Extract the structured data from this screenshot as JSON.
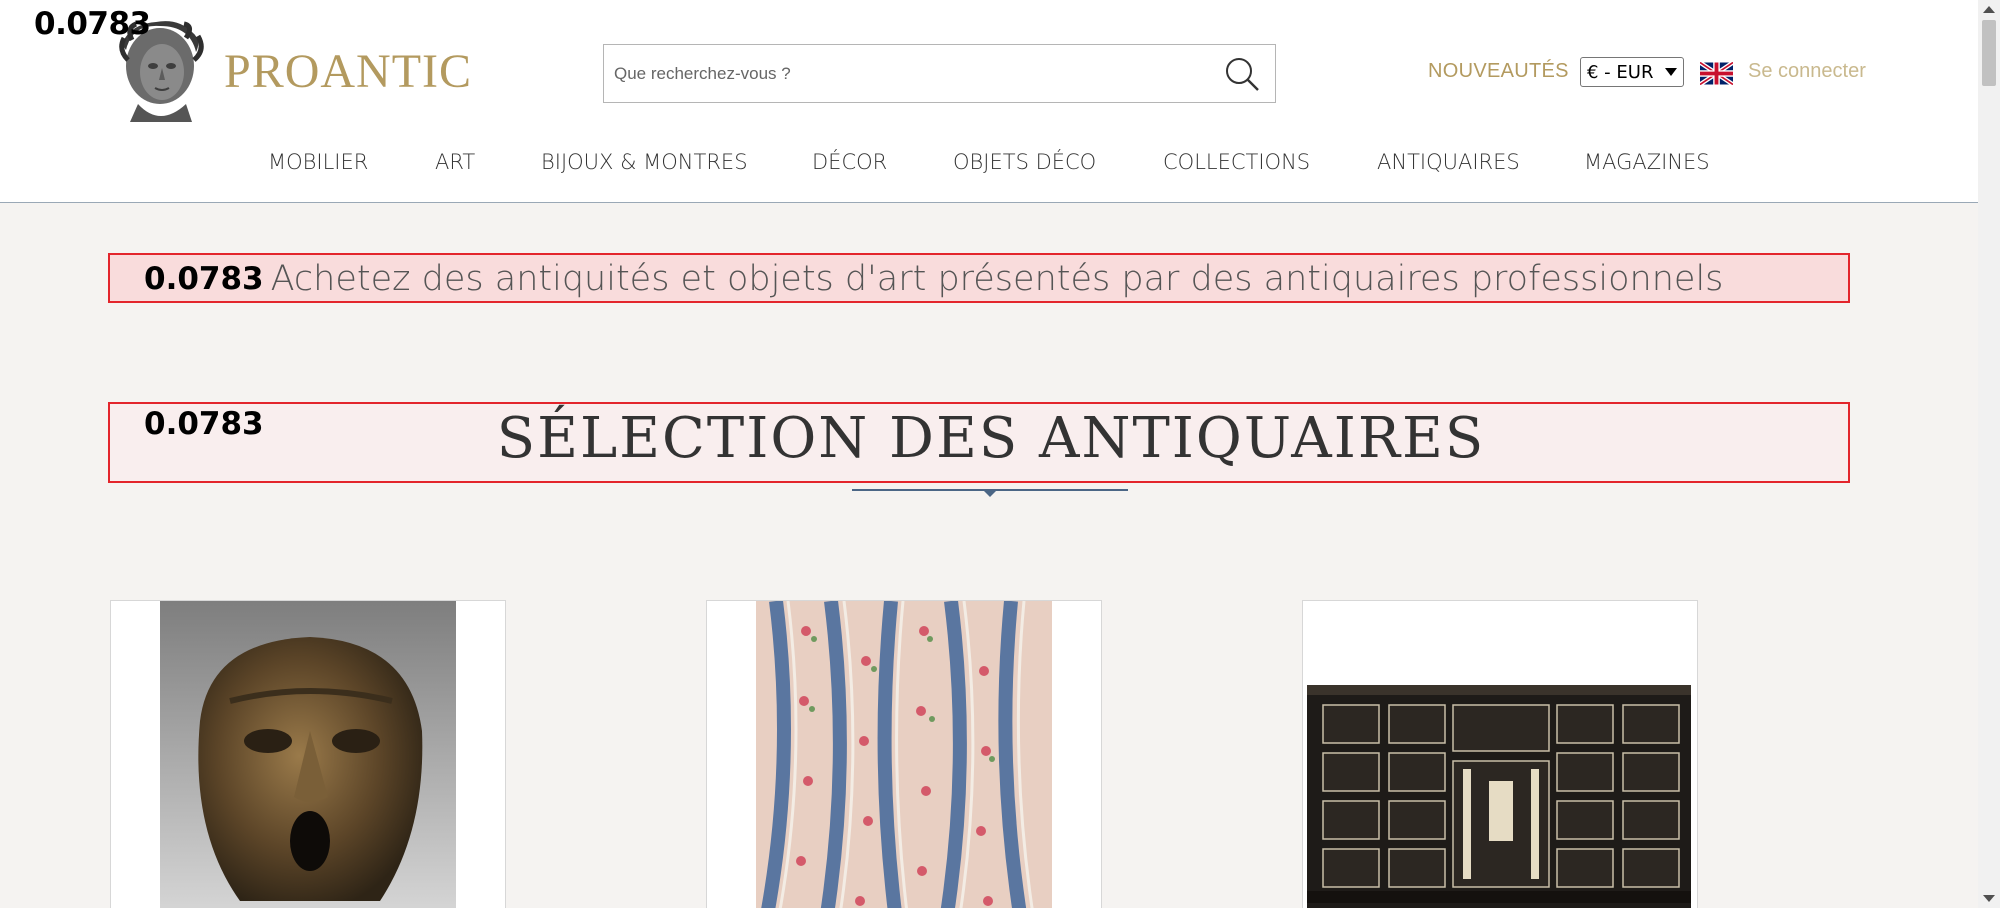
{
  "overlay_value": "0.0783",
  "header": {
    "brand": "PROANTIC",
    "search_placeholder": "Que recherchez-vous ?",
    "nouveautes": "NOUVEAUTÉS",
    "currency": "€ - EUR",
    "login": "Se connecter",
    "icons": [
      "bust-logo",
      "search-icon",
      "uk-flag-icon"
    ]
  },
  "nav": {
    "items": [
      "MOBILIER",
      "ART",
      "BIJOUX & MONTRES",
      "DÉCOR",
      "OBJETS DÉCO",
      "COLLECTIONS",
      "ANTIQUAIRES",
      "MAGAZINES"
    ]
  },
  "hero": {
    "tagline": "Achetez des antiquités et objets d'art présentés par des antiquaires professionnels",
    "section_title": "SÉLECTION DES ANTIQUAIRES"
  },
  "colors": {
    "brand_gold": "#b39a5f",
    "highlight_border": "#e3252c",
    "rule_blue": "#4a6686"
  }
}
